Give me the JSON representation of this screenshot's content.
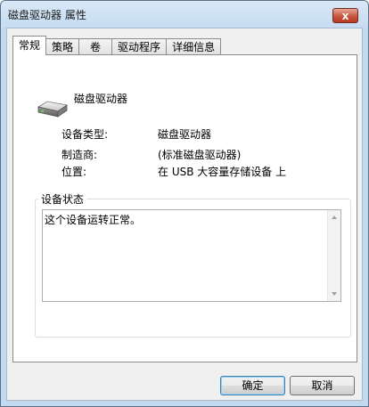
{
  "window": {
    "title": "磁盘驱动器 属性",
    "close_label": "x"
  },
  "tabs": [
    {
      "label": "常规",
      "active": true
    },
    {
      "label": "策略",
      "active": false
    },
    {
      "label": "卷",
      "active": false
    },
    {
      "label": "驱动程序",
      "active": false
    },
    {
      "label": "详细信息",
      "active": false
    }
  ],
  "general": {
    "icon": "disk-drive-icon",
    "device_name": "磁盘驱动器",
    "properties": [
      {
        "label": "设备类型:",
        "value": "磁盘驱动器"
      },
      {
        "label": "制造商:",
        "value": "(标准磁盘驱动器)"
      },
      {
        "label": "位置:",
        "value": "在 USB 大容量存储设备 上"
      }
    ],
    "status_group_title": "设备状态",
    "status_text": "这个设备运转正常。"
  },
  "buttons": {
    "ok": "确定",
    "cancel": "取消"
  }
}
